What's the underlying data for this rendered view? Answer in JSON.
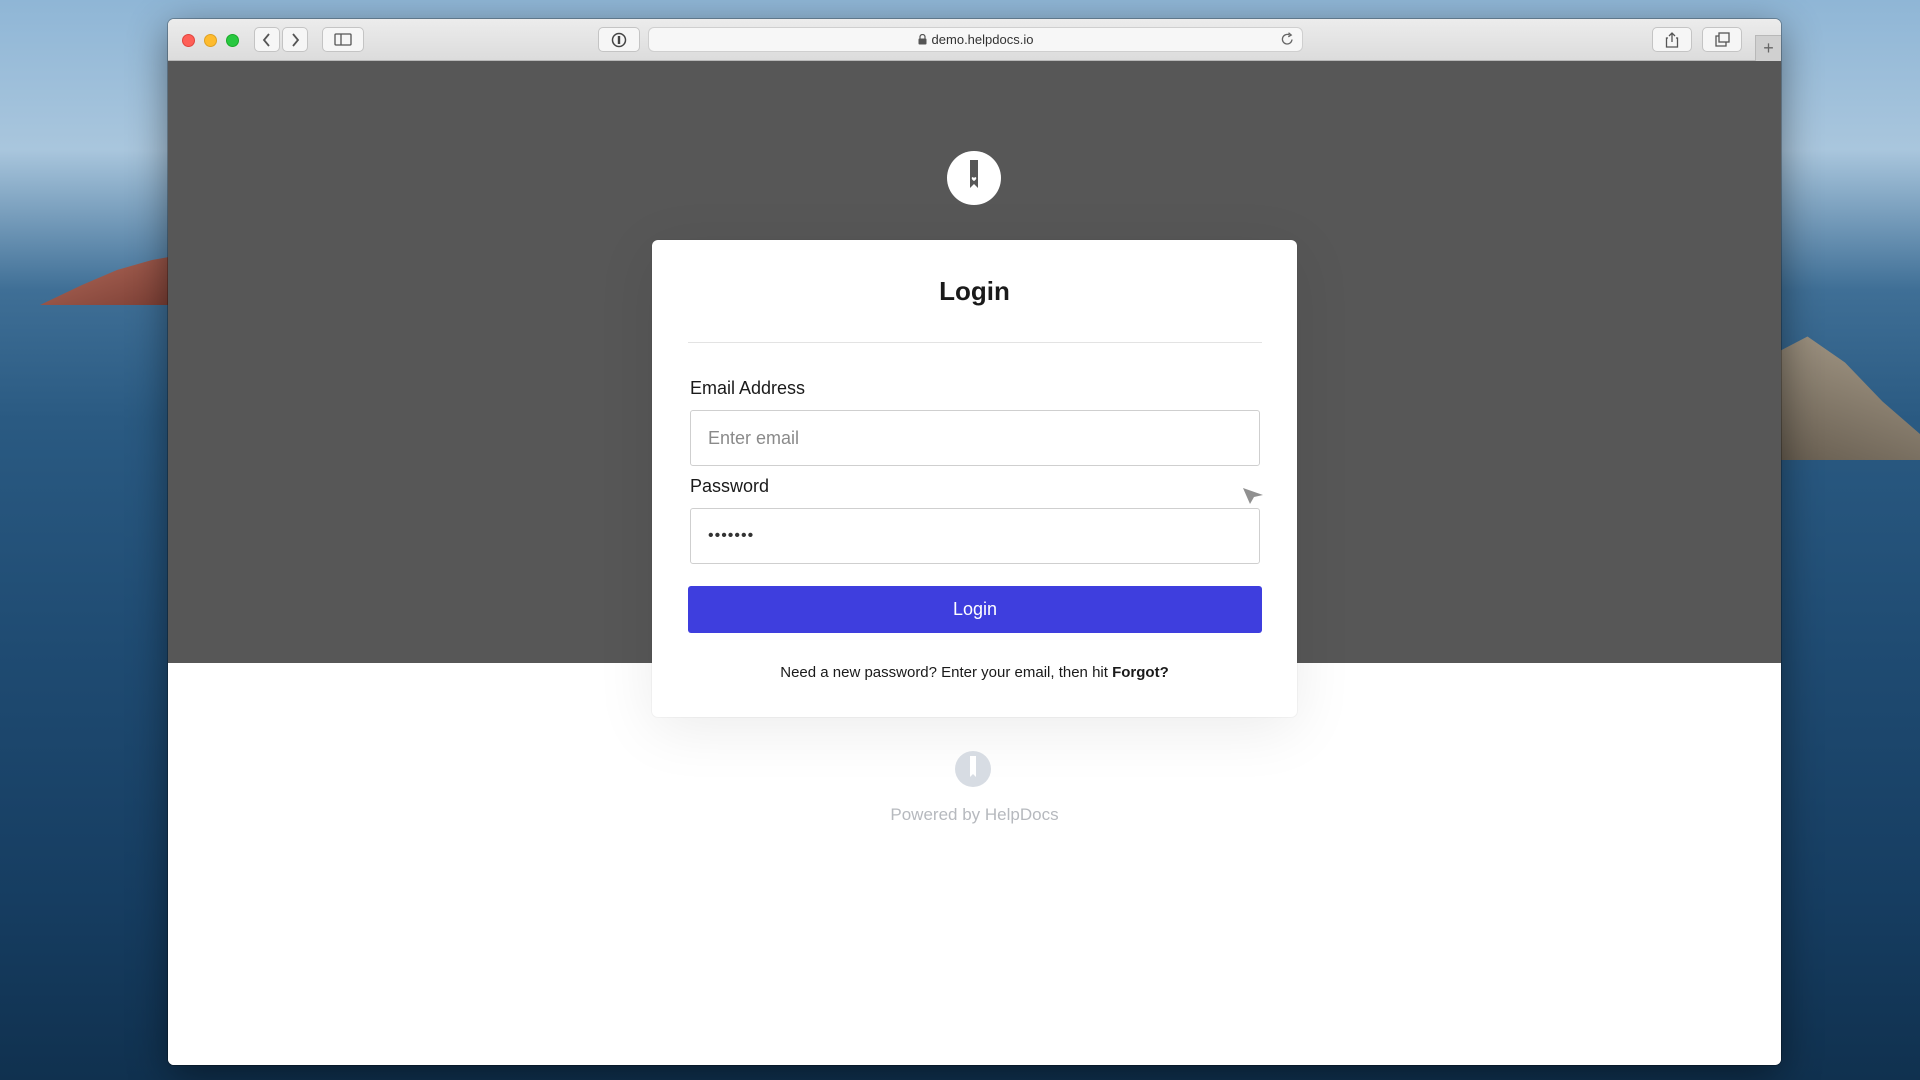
{
  "browser": {
    "url": "demo.helpdocs.io",
    "icons": [
      "back-chevron-icon",
      "forward-chevron-icon",
      "sidebar-icon",
      "password-manager-icon",
      "lock-icon",
      "reload-icon",
      "share-icon",
      "tabs-icon",
      "plus-icon"
    ]
  },
  "login": {
    "title": "Login",
    "email_label": "Email Address",
    "email_placeholder": "Enter email",
    "email_value": "",
    "password_label": "Password",
    "password_value": "•••••••",
    "submit_label": "Login",
    "hint_text": "Need a new password? Enter your email, then hit ",
    "hint_link": "Forgot?"
  },
  "footer": {
    "powered_by": "Powered by HelpDocs"
  },
  "colors": {
    "accent": "#3e3ede",
    "hero_band": "#575757",
    "footer_text": "#b6b9be"
  }
}
